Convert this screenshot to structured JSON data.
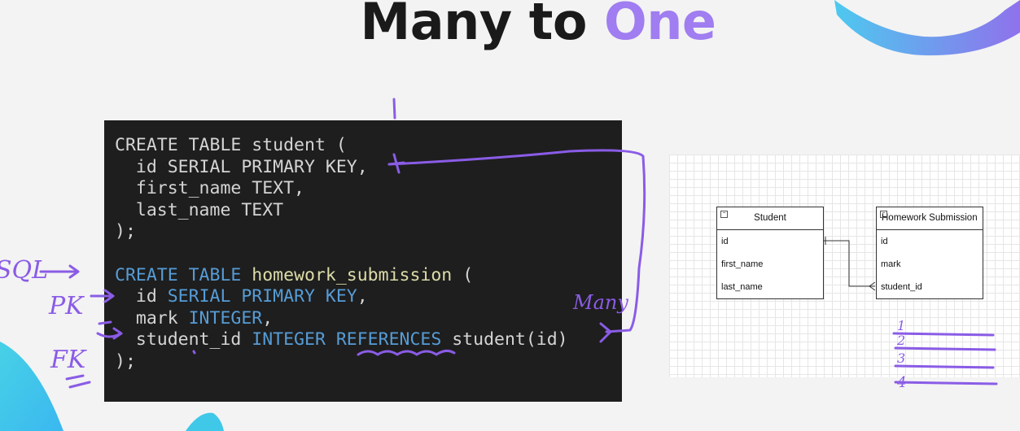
{
  "title": {
    "main": "Many to ",
    "accent": "One"
  },
  "code": {
    "lines": [
      "CREATE TABLE student (",
      "  id SERIAL PRIMARY KEY,",
      "  first_name TEXT,",
      "  last_name TEXT",
      ");",
      "",
      "CREATE TABLE homework_submission (",
      "  id SERIAL PRIMARY KEY,",
      "  mark INTEGER,",
      "  student_id INTEGER REFERENCES student(id)",
      ");"
    ]
  },
  "erd": {
    "student": {
      "name": "Student",
      "fields": [
        "id",
        "first_name",
        "last_name"
      ]
    },
    "homework": {
      "name": "Homework Submission",
      "fields": [
        "id",
        "mark",
        "student_id"
      ]
    }
  },
  "annotations": {
    "sql": "SQL",
    "pk": "PK",
    "fk": "FK",
    "many": "Many",
    "one": "1",
    "counts": [
      "1",
      "2",
      "3",
      "4"
    ]
  },
  "colors": {
    "accent": "#a07df0",
    "ink": "#8a5ce6",
    "code_bg": "#1e1e1e",
    "keyword": "#569cd6",
    "name": "#dcdcaa"
  }
}
